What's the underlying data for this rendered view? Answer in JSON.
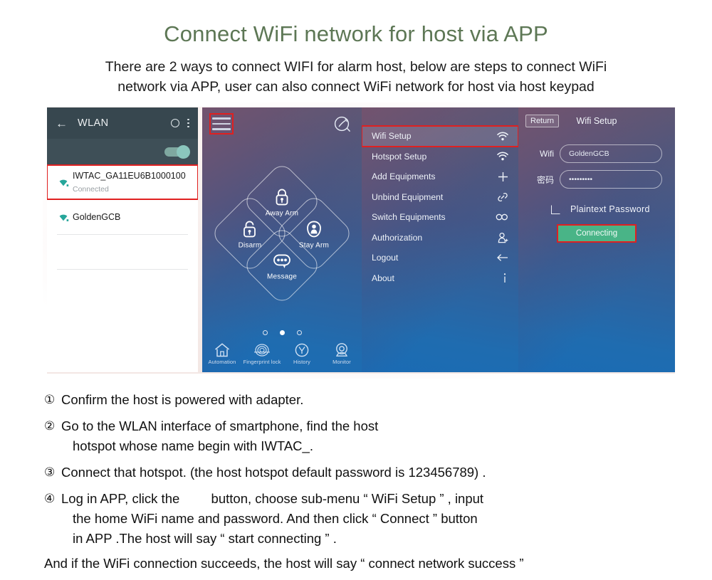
{
  "header": {
    "title": "Connect WiFi network for host via APP",
    "subtitle_line1": "There are 2 ways to connect WIFI for alarm host, below are steps to connect WiFi",
    "subtitle_line2": "network via APP, user can also connect WiFi network for host via host keypad",
    "title_color": "#5d7755"
  },
  "screen_wlan": {
    "back_icon": "back-arrow-icon",
    "title": "WLAN",
    "menu_icon": "overflow-menu-icon",
    "circle_icon": "circle-icon",
    "toggle_state": "on",
    "networks": [
      {
        "ssid": "IWTAC_GA11EU6B1000100",
        "status": "Connected",
        "highlighted": true
      },
      {
        "ssid": "GoldenGCB",
        "status": "",
        "highlighted": false
      }
    ],
    "highlight_color": "#e02020"
  },
  "screen_home": {
    "hamburger_icon": "hamburger-menu-icon",
    "scan_icon": "scan-signal-icon",
    "tiles": [
      {
        "label": "Away Arm",
        "icon": "padlock-closed-icon"
      },
      {
        "label": "Disarm",
        "icon": "padlock-open-icon"
      },
      {
        "label": "Stay Arm",
        "icon": "person-shield-icon"
      },
      {
        "label": "Message",
        "icon": "chat-bubble-icon"
      }
    ],
    "pager": {
      "total": 3,
      "active_index": 1
    },
    "tabs": [
      {
        "label": "Automation",
        "icon": "home-icon"
      },
      {
        "label": "Fingerprint lock",
        "icon": "fingerprint-icon"
      },
      {
        "label": "History",
        "icon": "clock-icon"
      },
      {
        "label": "Monitor",
        "icon": "camera-icon"
      }
    ]
  },
  "screen_menu": {
    "items": [
      {
        "label": "Wifi Setup",
        "icon": "wifi-icon",
        "selected": true
      },
      {
        "label": "Hotspot Setup",
        "icon": "wifi-icon",
        "selected": false
      },
      {
        "label": "Add Equipments",
        "icon": "plus-icon",
        "selected": false
      },
      {
        "label": "Unbind Equipment",
        "icon": "link-icon",
        "selected": false
      },
      {
        "label": "Switch Equipments",
        "icon": "infinity-icon",
        "selected": false
      },
      {
        "label": "Authorization",
        "icon": "add-user-icon",
        "selected": false
      },
      {
        "label": "Logout",
        "icon": "left-arrow-icon",
        "selected": false
      },
      {
        "label": "About",
        "icon": "info-icon",
        "selected": false
      }
    ]
  },
  "screen_wifi_setup": {
    "return_label": "Return",
    "title": "Wifi Setup",
    "wifi_label": "Wifi",
    "wifi_value": "GoldenGCB",
    "password_label": "密码",
    "password_value": "•••••••••",
    "checkbox_label": "Plaintext Password",
    "checkbox_icon": "checkbox-unchecked-icon",
    "button_label": "Connecting",
    "button_color": "#49b487"
  },
  "steps": [
    {
      "num": "①",
      "line1": "Confirm the host is powered with adapter.",
      "line2": ""
    },
    {
      "num": "②",
      "line1": "Go to the WLAN interface of smartphone, find the host",
      "line2": "hotspot whose name begin with IWTAC_."
    },
    {
      "num": "③",
      "line1": "Connect that hotspot. (the host hotspot default password is 123456789) .",
      "line2": ""
    }
  ],
  "step4": {
    "num": "④",
    "line1_a": "Log in APP, click the",
    "line1_b": "button, choose sub-menu “ WiFi Setup ” , input",
    "line2": "the home WiFi name and password. And then click “ Connect ” button",
    "line3": "in APP .The host will say “  start connecting ” ."
  },
  "tail": "And if the WiFi connection succeeds, the host will say “ connect network success ”"
}
